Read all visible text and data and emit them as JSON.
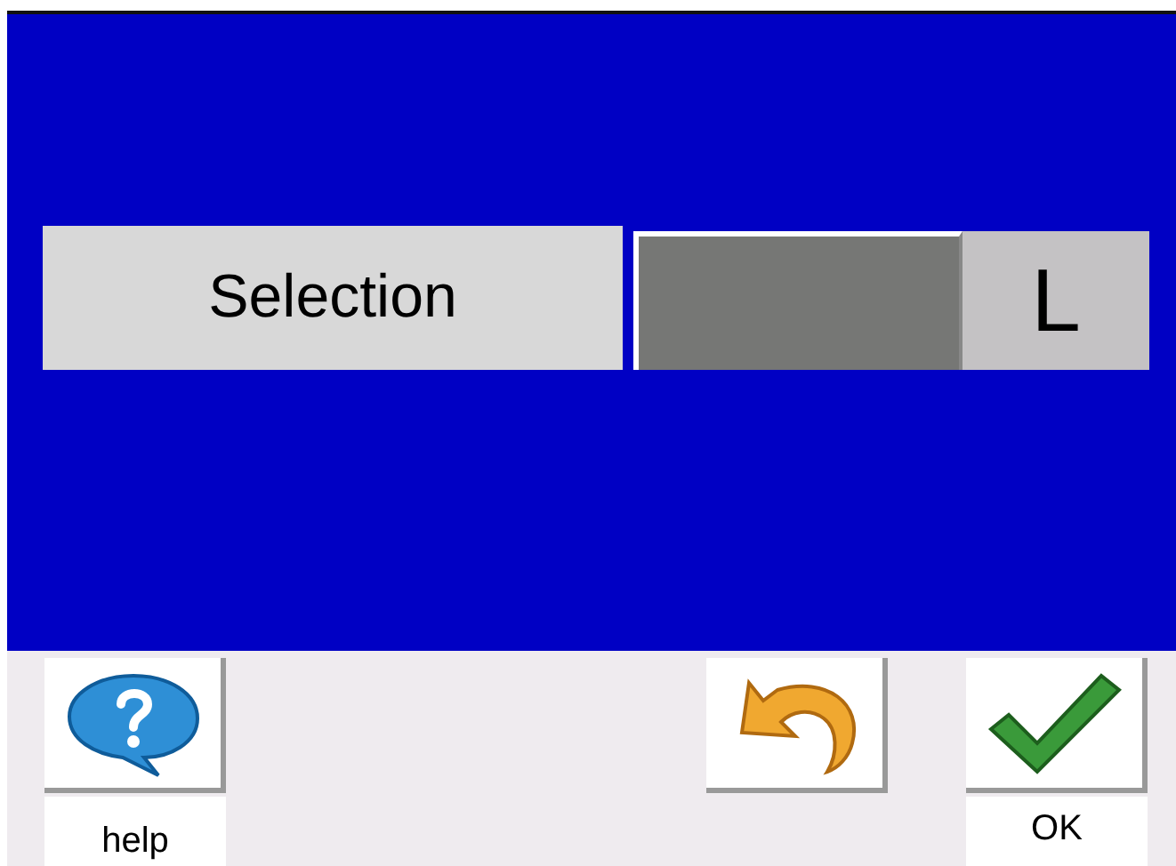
{
  "selection": {
    "label": "Selection",
    "value": "L"
  },
  "buttons": [
    {
      "kind": "help",
      "label": "help"
    },
    {
      "kind": "undo"
    },
    {
      "kind": "ok",
      "label": "OK"
    }
  ]
}
